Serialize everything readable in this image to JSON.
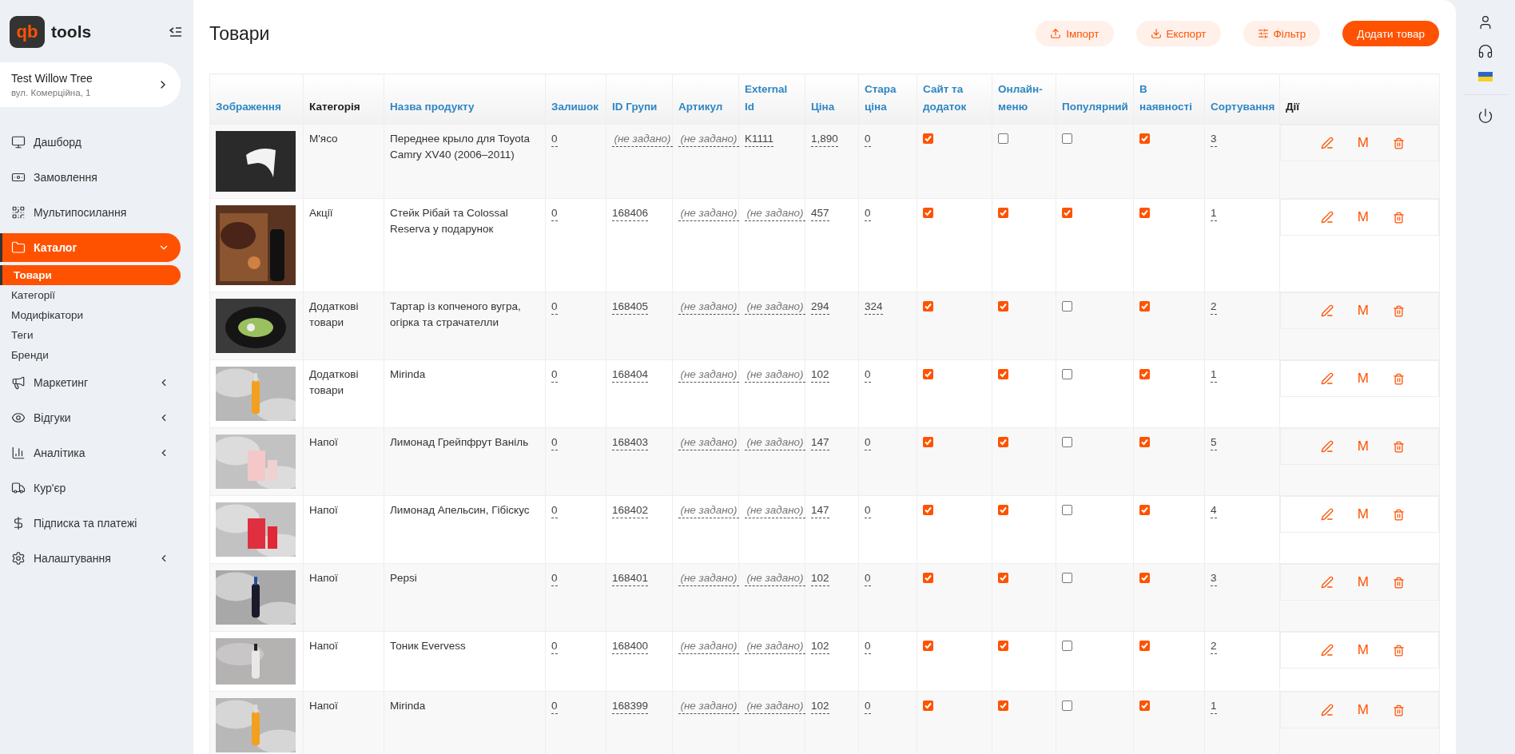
{
  "logo": {
    "mark": "qb",
    "name": "tools"
  },
  "store": {
    "name": "Test Willow Tree",
    "address": "вул. Комерційна, 1"
  },
  "nav": [
    {
      "label": "Дашборд",
      "kind": "link",
      "selected": false
    },
    {
      "label": "Замовлення",
      "kind": "link",
      "selected": false
    },
    {
      "label": "Мультипосилання",
      "kind": "link",
      "selected": false
    },
    {
      "label": "Каталог",
      "kind": "group",
      "selected": true,
      "expanded": true,
      "children": [
        {
          "label": "Товари",
          "selected": true
        },
        {
          "label": "Категорії",
          "selected": false
        },
        {
          "label": "Модифікатори",
          "selected": false
        },
        {
          "label": "Теги",
          "selected": false
        },
        {
          "label": "Бренди",
          "selected": false
        }
      ]
    },
    {
      "label": "Маркетинг",
      "kind": "group",
      "selected": false,
      "expanded": false
    },
    {
      "label": "Відгуки",
      "kind": "group",
      "selected": false,
      "expanded": false
    },
    {
      "label": "Аналітика",
      "kind": "group",
      "selected": false,
      "expanded": false
    },
    {
      "label": "Кур'єр",
      "kind": "link",
      "selected": false
    },
    {
      "label": "Підписка та платежі",
      "kind": "link",
      "selected": false
    },
    {
      "label": "Налаштування",
      "kind": "group",
      "selected": false,
      "expanded": false
    }
  ],
  "page_title": "Товари",
  "toolbar": [
    {
      "label": "Імпорт",
      "kind": "import"
    },
    {
      "label": "Експорт",
      "kind": "export"
    },
    {
      "label": "Фільтр",
      "kind": "filter"
    },
    {
      "label": "Додати товар",
      "kind": "primary"
    }
  ],
  "table": {
    "columns": [
      {
        "label": "Зображення",
        "sortable": true
      },
      {
        "label": "Категорія",
        "sortable": false
      },
      {
        "label": "Назва продукту",
        "sortable": true
      },
      {
        "label": "Залишок",
        "sortable": true
      },
      {
        "label": "ID Групи",
        "sortable": true
      },
      {
        "label": "Артикул",
        "sortable": true
      },
      {
        "label": "External Id",
        "sortable": true
      },
      {
        "label": "Ціна",
        "sortable": true
      },
      {
        "label": "Стара ціна",
        "sortable": true
      },
      {
        "label": "Сайт та додаток",
        "sortable": true
      },
      {
        "label": "Онлайн-меню",
        "sortable": true
      },
      {
        "label": "Популярний",
        "sortable": true
      },
      {
        "label": "В наявності",
        "sortable": true
      },
      {
        "label": "Сортування",
        "sortable": true
      },
      {
        "label": "Дії",
        "sortable": false
      }
    ],
    "rows": [
      {
        "category": "М'ясо",
        "name": "Переднее крыло для Toyota Camry XV40 (2006–2011)",
        "stock": "0",
        "group_id": {
          "text": "(не задано)",
          "unset": true
        },
        "article": {
          "text": "(не задано)",
          "unset": true
        },
        "external_id": {
          "text": "K1111",
          "unset": false
        },
        "price": "1,890",
        "old_price": "0",
        "site": true,
        "online": false,
        "popular": false,
        "available": true,
        "sort": "3",
        "modifier_button": "M"
      },
      {
        "category": "Акції",
        "name": "Стейк Рібай та Colossal Reserva у подарунок",
        "stock": "0",
        "group_id": {
          "text": "168406",
          "unset": false
        },
        "article": {
          "text": "(не задано)",
          "unset": true
        },
        "external_id": {
          "text": "(не задано)",
          "unset": true
        },
        "price": "457",
        "old_price": "0",
        "site": true,
        "online": true,
        "popular": true,
        "available": true,
        "sort": "1",
        "modifier_button": "M"
      },
      {
        "category": "Додаткові товари",
        "name": "Тартар із копченого вугра, огірка та страчателли",
        "stock": "0",
        "group_id": {
          "text": "168405",
          "unset": false
        },
        "article": {
          "text": "(не задано)",
          "unset": true
        },
        "external_id": {
          "text": "(не задано)",
          "unset": true
        },
        "price": "294",
        "old_price": "324",
        "site": true,
        "online": true,
        "popular": false,
        "available": true,
        "sort": "2",
        "modifier_button": "M"
      },
      {
        "category": "Додаткові товари",
        "name": "Mirinda",
        "stock": "0",
        "group_id": {
          "text": "168404",
          "unset": false
        },
        "article": {
          "text": "(не задано)",
          "unset": true
        },
        "external_id": {
          "text": "(не задано)",
          "unset": true
        },
        "price": "102",
        "old_price": "0",
        "site": true,
        "online": true,
        "popular": false,
        "available": true,
        "sort": "1",
        "modifier_button": "M"
      },
      {
        "category": "Напої",
        "name": "Лимонад Грейпфрут Ваніль",
        "stock": "0",
        "group_id": {
          "text": "168403",
          "unset": false
        },
        "article": {
          "text": "(не задано)",
          "unset": true
        },
        "external_id": {
          "text": "(не задано)",
          "unset": true
        },
        "price": "147",
        "old_price": "0",
        "site": true,
        "online": true,
        "popular": false,
        "available": true,
        "sort": "5",
        "modifier_button": "M"
      },
      {
        "category": "Напої",
        "name": "Лимонад Апельсин, Гібіскус",
        "stock": "0",
        "group_id": {
          "text": "168402",
          "unset": false
        },
        "article": {
          "text": "(не задано)",
          "unset": true
        },
        "external_id": {
          "text": "(не задано)",
          "unset": true
        },
        "price": "147",
        "old_price": "0",
        "site": true,
        "online": true,
        "popular": false,
        "available": true,
        "sort": "4",
        "modifier_button": "M"
      },
      {
        "category": "Напої",
        "name": "Pepsi",
        "stock": "0",
        "group_id": {
          "text": "168401",
          "unset": false
        },
        "article": {
          "text": "(не задано)",
          "unset": true
        },
        "external_id": {
          "text": "(не задано)",
          "unset": true
        },
        "price": "102",
        "old_price": "0",
        "site": true,
        "online": true,
        "popular": false,
        "available": true,
        "sort": "3",
        "modifier_button": "M"
      },
      {
        "category": "Напої",
        "name": "Тоник Evervess",
        "stock": "0",
        "group_id": {
          "text": "168400",
          "unset": false
        },
        "article": {
          "text": "(не задано)",
          "unset": true
        },
        "external_id": {
          "text": "(не задано)",
          "unset": true
        },
        "price": "102",
        "old_price": "0",
        "site": true,
        "online": true,
        "popular": false,
        "available": true,
        "sort": "2",
        "modifier_button": "M"
      },
      {
        "category": "Напої",
        "name": "Mirinda",
        "stock": "0",
        "group_id": {
          "text": "168399",
          "unset": false
        },
        "article": {
          "text": "(не задано)",
          "unset": true
        },
        "external_id": {
          "text": "(не задано)",
          "unset": true
        },
        "price": "102",
        "old_price": "0",
        "site": true,
        "online": true,
        "popular": false,
        "available": true,
        "sort": "1",
        "modifier_button": "M"
      }
    ]
  }
}
